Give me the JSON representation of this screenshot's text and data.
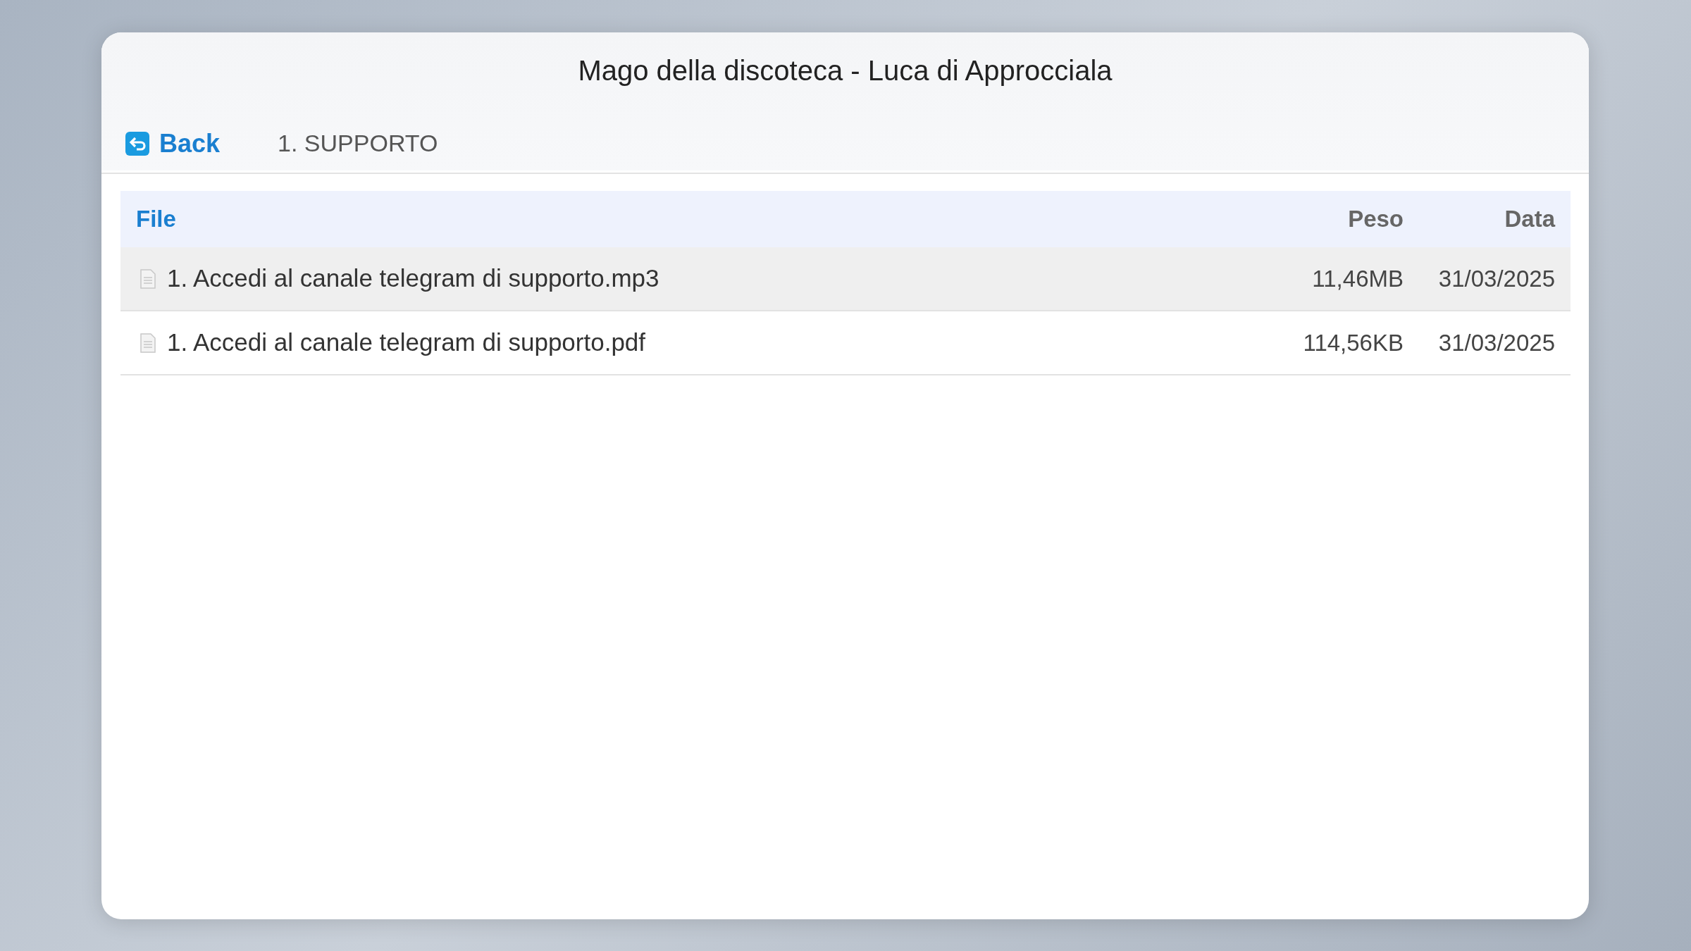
{
  "window": {
    "title": "Mago della discoteca - Luca di Approcciala"
  },
  "nav": {
    "back_label": "Back",
    "breadcrumb": "1. SUPPORTO"
  },
  "table": {
    "columns": [
      "File",
      "Peso",
      "Data"
    ],
    "rows": [
      {
        "name": "1. Accedi al canale telegram di supporto.mp3",
        "size": "11,46MB",
        "date": "31/03/2025",
        "selected": true
      },
      {
        "name": "1. Accedi al canale telegram di supporto.pdf",
        "size": "114,56KB",
        "date": "31/03/2025",
        "selected": false
      }
    ]
  }
}
